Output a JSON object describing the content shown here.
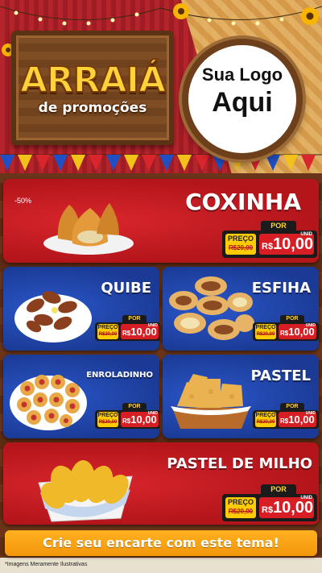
{
  "header": {
    "title": "ARRAIÁ",
    "subtitle": "de promoções",
    "logo_line1": "Sua Logo",
    "logo_line2": "Aqui"
  },
  "price_tag": {
    "por_label": "POR",
    "preco_label": "PREÇO",
    "unid_label": "UNID",
    "old_price": "R$20,00",
    "currency": "R$",
    "new_price": "10,00"
  },
  "products": [
    {
      "name": "COXINHA",
      "discount": "-50%"
    },
    {
      "name": "QUIBE"
    },
    {
      "name": "ESFIHA"
    },
    {
      "name": "ENROLADINHO"
    },
    {
      "name": "PASTEL"
    },
    {
      "name": "PASTEL DE MILHO"
    }
  ],
  "cta": "Crie seu encarte com este tema!",
  "footnote": "*Imagens Meramente Ilustrativas",
  "colors": {
    "red_card": "#b3151b",
    "blue_card": "#1b3a95",
    "price_red": "#d81e25",
    "price_yellow": "#ffcb05",
    "cta": "#f2960a"
  }
}
